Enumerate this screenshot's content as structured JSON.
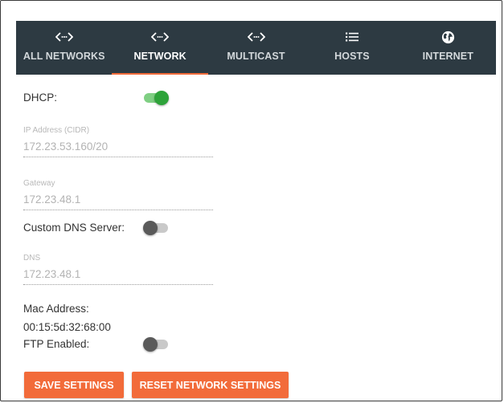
{
  "colors": {
    "tabbar_bg": "#2d3a42",
    "accent": "#f26b3a",
    "toggle_on": "#2ea33a"
  },
  "tabs": [
    {
      "label": "ALL NETWORKS",
      "icon": "code-brackets-icon",
      "active": false
    },
    {
      "label": "NETWORK",
      "icon": "code-brackets-icon",
      "active": true
    },
    {
      "label": "MULTICAST",
      "icon": "code-brackets-icon",
      "active": false
    },
    {
      "label": "HOSTS",
      "icon": "list-icon",
      "active": false
    },
    {
      "label": "INTERNET",
      "icon": "globe-icon",
      "active": false
    }
  ],
  "dhcp": {
    "label": "DHCP:",
    "enabled": true
  },
  "ip_field": {
    "label": "IP Address (CIDR)",
    "value": "172.23.53.160/20"
  },
  "gateway_field": {
    "label": "Gateway",
    "value": "172.23.48.1"
  },
  "custom_dns": {
    "label": "Custom DNS Server:",
    "enabled": false
  },
  "dns_field": {
    "label": "DNS",
    "value": "172.23.48.1"
  },
  "mac": {
    "label": "Mac Address:",
    "value": "00:15:5d:32:68:00"
  },
  "ftp": {
    "label": "FTP Enabled:",
    "enabled": false
  },
  "buttons": {
    "save": "SAVE SETTINGS",
    "reset": "RESET NETWORK SETTINGS"
  }
}
